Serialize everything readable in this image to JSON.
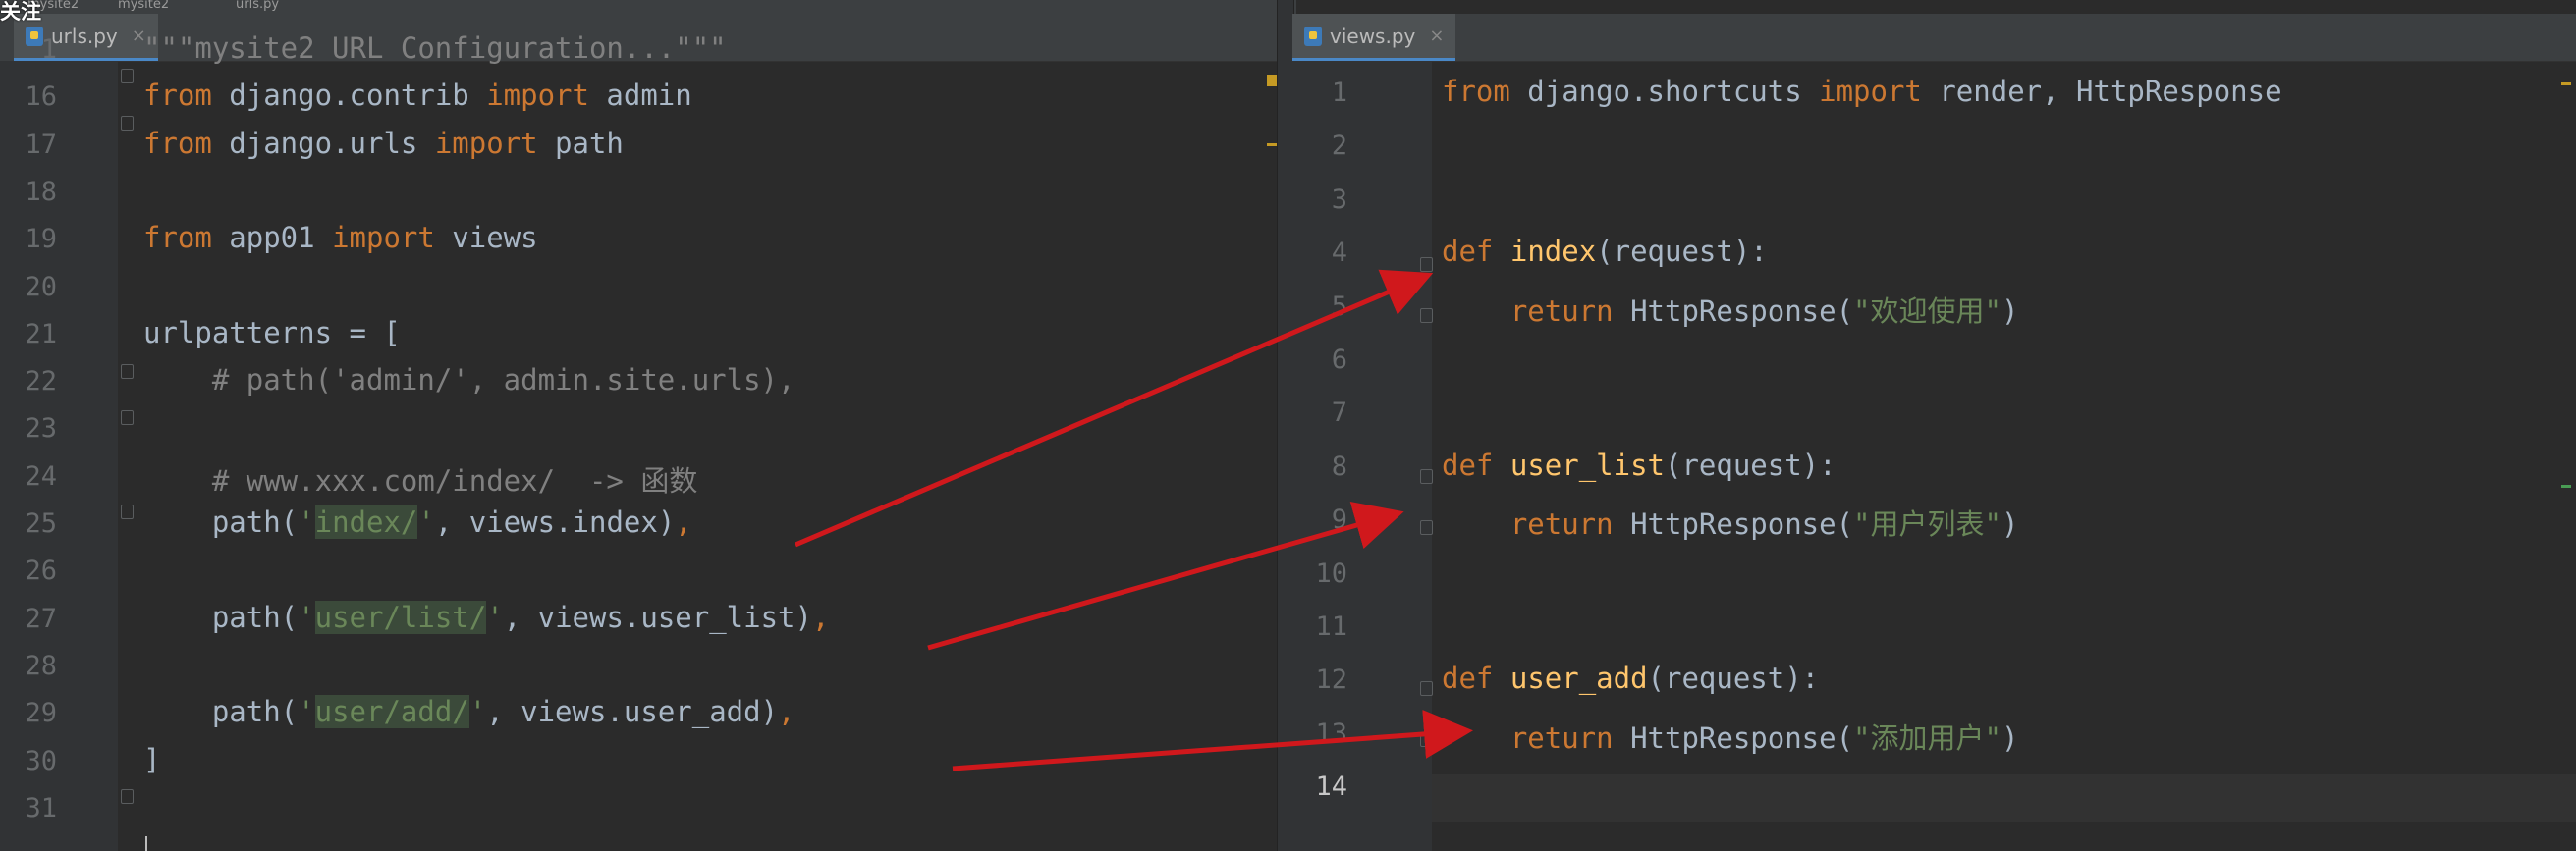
{
  "watermark": "关注",
  "breadcrumb": [
    "mysite2",
    "mysite2",
    "urls.py"
  ],
  "left_tab": {
    "label": "urls.py",
    "close": "×"
  },
  "right_tab": {
    "label": "views.py",
    "close": "×"
  },
  "urls_editor": {
    "lines": [
      {
        "n": "1",
        "code": "\"\"\"mysite2 URL Configuration...\"\"\""
      },
      {
        "n": "16",
        "code": "from django.contrib import admin"
      },
      {
        "n": "17",
        "code": "from django.urls import path"
      },
      {
        "n": "18",
        "code": ""
      },
      {
        "n": "19",
        "code": "from app01 import views"
      },
      {
        "n": "20",
        "code": ""
      },
      {
        "n": "21",
        "code": "urlpatterns = ["
      },
      {
        "n": "22",
        "code": "    # path('admin/', admin.site.urls),"
      },
      {
        "n": "23",
        "code": ""
      },
      {
        "n": "24",
        "code": "    # www.xxx.com/index/  -> 函数"
      },
      {
        "n": "25",
        "code": "    path('index/', views.index),"
      },
      {
        "n": "26",
        "code": ""
      },
      {
        "n": "27",
        "code": "    path('user/list/', views.user_list),"
      },
      {
        "n": "28",
        "code": ""
      },
      {
        "n": "29",
        "code": "    path('user/add/', views.user_add),"
      },
      {
        "n": "30",
        "code": "]"
      },
      {
        "n": "31",
        "code": ""
      }
    ]
  },
  "views_editor": {
    "lines": [
      {
        "n": "1",
        "code": "from django.shortcuts import render, HttpResponse"
      },
      {
        "n": "2",
        "code": ""
      },
      {
        "n": "3",
        "code": ""
      },
      {
        "n": "4",
        "code": "def index(request):"
      },
      {
        "n": "5",
        "code": "    return HttpResponse(\"欢迎使用\")"
      },
      {
        "n": "6",
        "code": ""
      },
      {
        "n": "7",
        "code": ""
      },
      {
        "n": "8",
        "code": "def user_list(request):"
      },
      {
        "n": "9",
        "code": "    return HttpResponse(\"用户列表\")"
      },
      {
        "n": "10",
        "code": ""
      },
      {
        "n": "11",
        "code": ""
      },
      {
        "n": "12",
        "code": "def user_add(request):"
      },
      {
        "n": "13",
        "code": "    return HttpResponse(\"添加用户\")"
      },
      {
        "n": "14",
        "code": ""
      }
    ]
  },
  "colors": {
    "background": "#2b2b2b",
    "gutter": "#313335",
    "keyword": "#cc7832",
    "comment": "#808080",
    "string": "#6a8759",
    "function": "#ffc66d",
    "default": "#a9b7c6",
    "arrow": "#d0181c"
  },
  "annotations": [
    {
      "from": "urls.py line 25",
      "to": "views.py line 4",
      "icon": "arrow-icon"
    },
    {
      "from": "urls.py line 27",
      "to": "views.py line 9",
      "icon": "arrow-icon"
    },
    {
      "from": "urls.py line 29",
      "to": "views.py line 13",
      "icon": "arrow-icon"
    }
  ]
}
